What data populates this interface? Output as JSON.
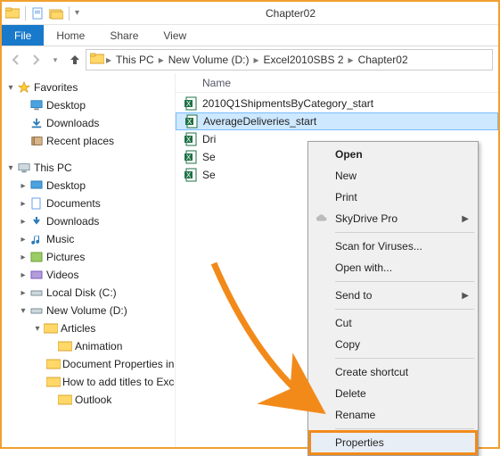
{
  "window": {
    "title": "Chapter02"
  },
  "tabs": {
    "file": "File",
    "home": "Home",
    "share": "Share",
    "view": "View"
  },
  "breadcrumb": {
    "parts": [
      "This PC",
      "New Volume (D:)",
      "Excel2010SBS 2",
      "Chapter02"
    ]
  },
  "sidebar": {
    "favorites": {
      "label": "Favorites",
      "items": [
        {
          "label": "Desktop"
        },
        {
          "label": "Downloads"
        },
        {
          "label": "Recent places"
        }
      ]
    },
    "thispc": {
      "label": "This PC",
      "items": [
        {
          "label": "Desktop"
        },
        {
          "label": "Documents"
        },
        {
          "label": "Downloads"
        },
        {
          "label": "Music"
        },
        {
          "label": "Pictures"
        },
        {
          "label": "Videos"
        },
        {
          "label": "Local Disk (C:)"
        }
      ],
      "newvolume": {
        "label": "New Volume (D:)",
        "articles": {
          "label": "Articles",
          "items": [
            {
              "label": "Animation"
            },
            {
              "label": "Document Properties in Excel"
            },
            {
              "label": "How to add titles to Excel charts"
            },
            {
              "label": "Outlook"
            }
          ]
        }
      }
    }
  },
  "content": {
    "header_name": "Name",
    "files": [
      {
        "name": "2010Q1ShipmentsByCategory_start"
      },
      {
        "name": "AverageDeliveries_start",
        "selected": true
      },
      {
        "name": "Dri",
        "truncated": true
      },
      {
        "name": "Se",
        "truncated": true
      },
      {
        "name": "Se",
        "truncated": true
      }
    ]
  },
  "context_menu": {
    "items": {
      "open": "Open",
      "new": "New",
      "print": "Print",
      "skydrive": "SkyDrive Pro",
      "scan": "Scan for Viruses...",
      "openwith": "Open with...",
      "sendto": "Send to",
      "cut": "Cut",
      "copy": "Copy",
      "shortcut": "Create shortcut",
      "delete": "Delete",
      "rename": "Rename",
      "properties": "Properties"
    }
  },
  "colors": {
    "accent_orange": "#f28a1a",
    "ribbon_blue": "#1979ca",
    "selection": "#cde8ff"
  }
}
